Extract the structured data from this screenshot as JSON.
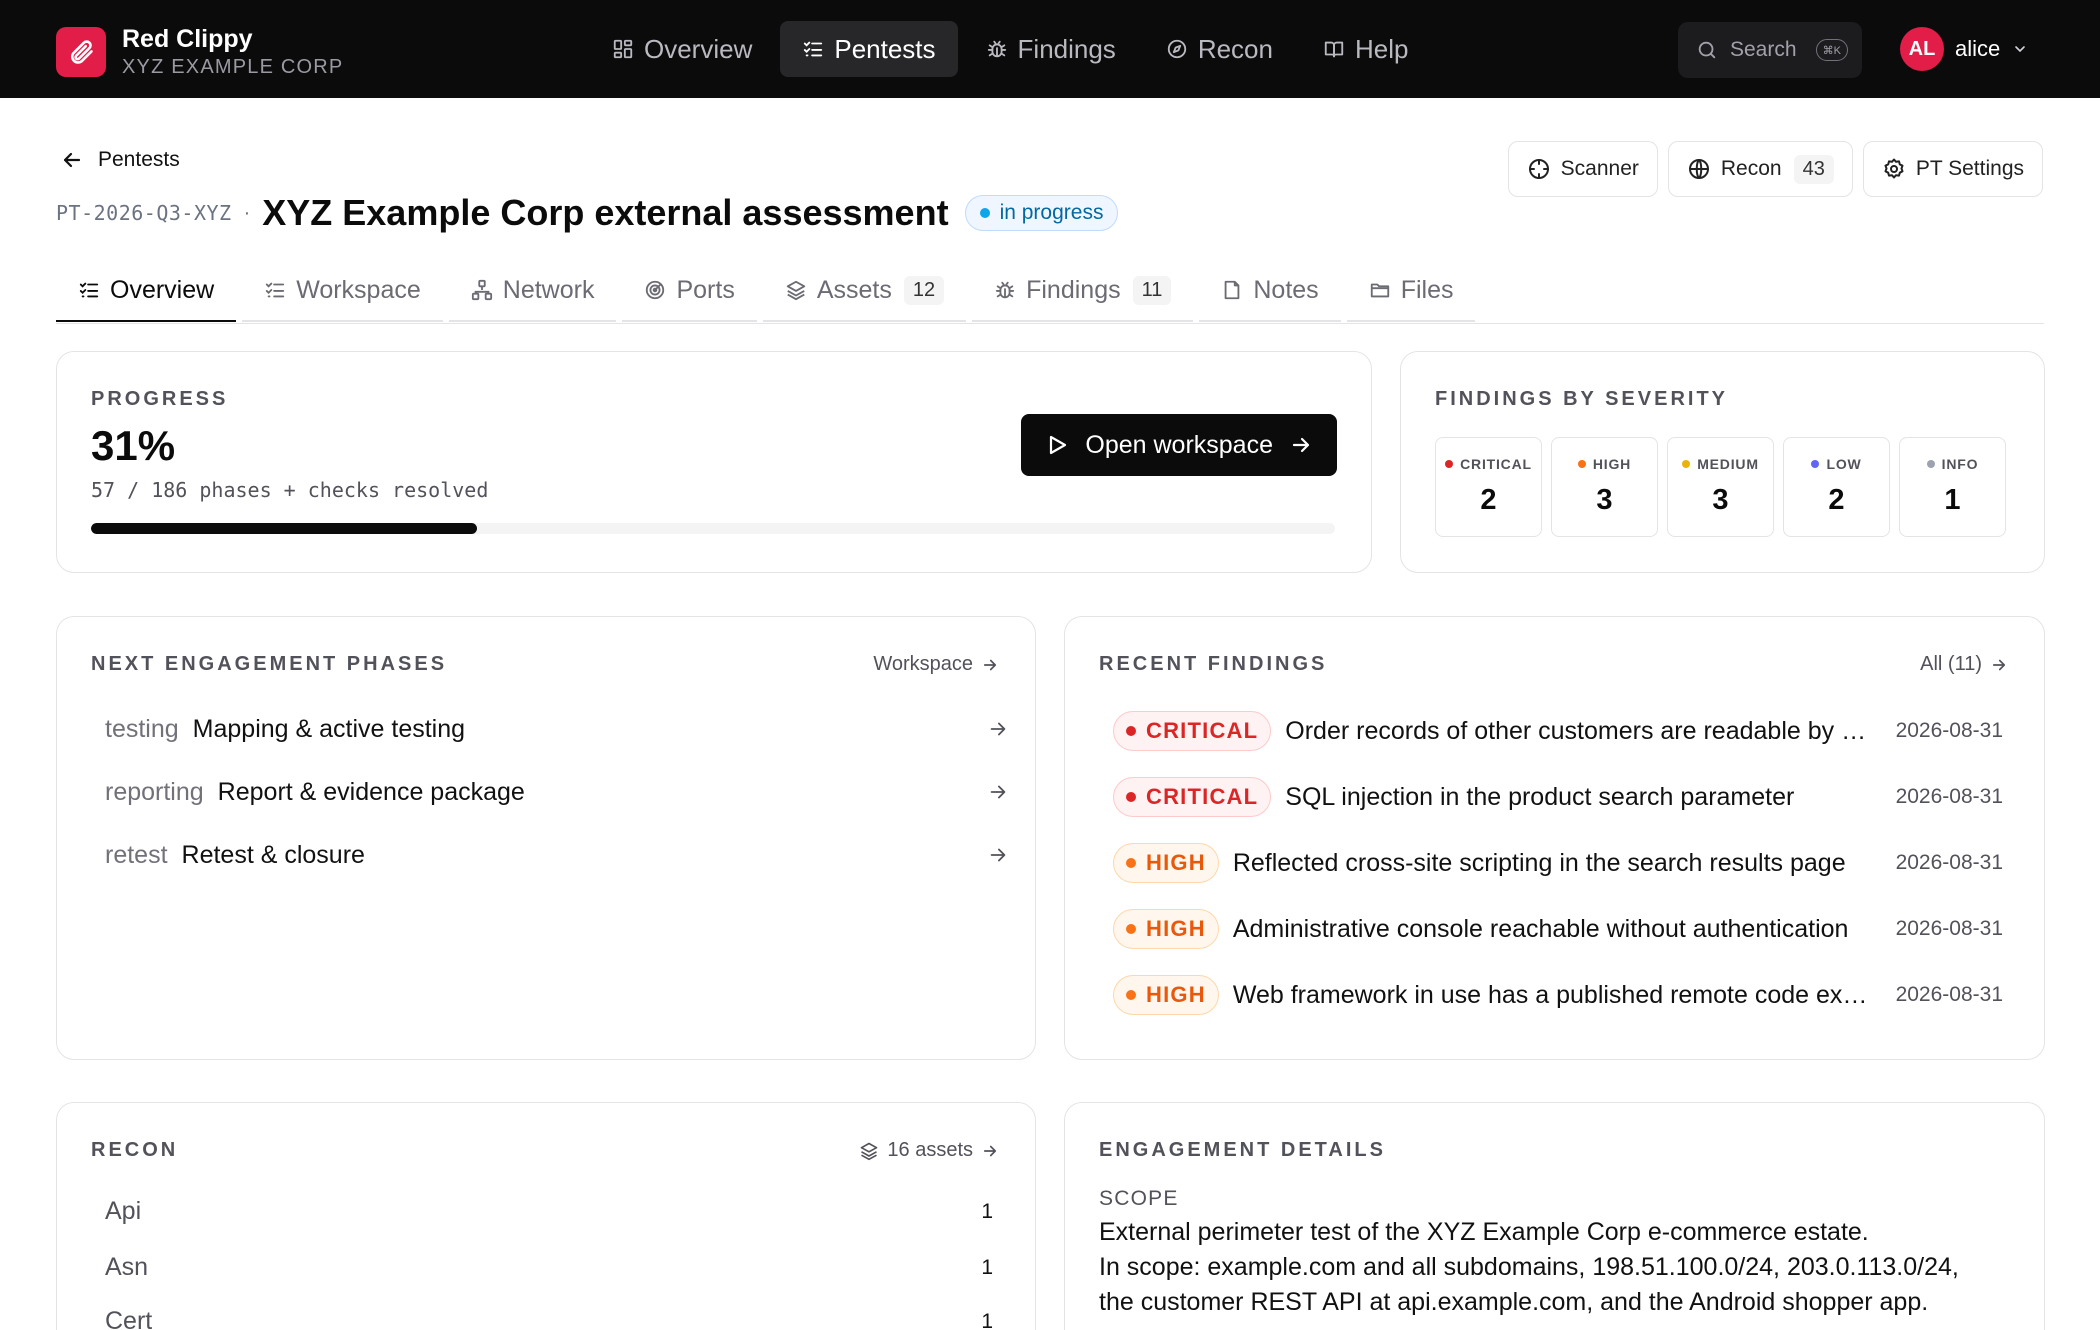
{
  "app": {
    "name": "Red Clippy",
    "org": "XYZ EXAMPLE CORP",
    "nav": [
      {
        "label": "Overview",
        "icon": "grid-icon",
        "active": false
      },
      {
        "label": "Pentests",
        "icon": "checklist-icon",
        "active": true
      },
      {
        "label": "Findings",
        "icon": "bug-icon",
        "active": false
      },
      {
        "label": "Recon",
        "icon": "compass-icon",
        "active": false
      },
      {
        "label": "Help",
        "icon": "book-icon",
        "active": false
      }
    ],
    "search_label": "Search",
    "search_shortcut": "⌘K",
    "user": {
      "initials": "AL",
      "name": "alice"
    }
  },
  "header": {
    "back_label": "Pentests",
    "id": "PT-2026-Q3-XYZ",
    "separator": "·",
    "title": "XYZ Example Corp external assessment",
    "status": "in progress",
    "actions": {
      "scanner": "Scanner",
      "recon": "Recon",
      "recon_count": "43",
      "settings": "PT Settings"
    }
  },
  "tabs": [
    {
      "label": "Overview",
      "active": true
    },
    {
      "label": "Workspace"
    },
    {
      "label": "Network"
    },
    {
      "label": "Ports"
    },
    {
      "label": "Assets",
      "count": "12"
    },
    {
      "label": "Findings",
      "count": "11"
    },
    {
      "label": "Notes"
    },
    {
      "label": "Files"
    }
  ],
  "progress": {
    "label": "PROGRESS",
    "percent_text": "31%",
    "percent_value": 31,
    "summary": "57 / 186 phases + checks resolved",
    "button": "Open workspace"
  },
  "severity": {
    "label": "FINDINGS BY SEVERITY",
    "items": [
      {
        "name": "CRITICAL",
        "count": "2",
        "color": "#dc2626"
      },
      {
        "name": "HIGH",
        "count": "3",
        "color": "#f97316"
      },
      {
        "name": "MEDIUM",
        "count": "3",
        "color": "#eab308"
      },
      {
        "name": "LOW",
        "count": "2",
        "color": "#6366f1"
      },
      {
        "name": "INFO",
        "count": "1",
        "color": "#9ca3af"
      }
    ]
  },
  "phases": {
    "label": "NEXT ENGAGEMENT PHASES",
    "link": "Workspace",
    "items": [
      {
        "key": "testing",
        "name": "Mapping & active testing"
      },
      {
        "key": "reporting",
        "name": "Report & evidence package"
      },
      {
        "key": "retest",
        "name": "Retest & closure"
      }
    ]
  },
  "recent_findings": {
    "label": "RECENT FINDINGS",
    "link": "All (11)",
    "items": [
      {
        "severity": "CRITICAL",
        "title": "Order records of other customers are readable by changing the order ID",
        "date": "2026-08-31"
      },
      {
        "severity": "CRITICAL",
        "title": "SQL injection in the product search parameter",
        "date": "2026-08-31"
      },
      {
        "severity": "HIGH",
        "title": "Reflected cross-site scripting in the search results page",
        "date": "2026-08-31"
      },
      {
        "severity": "HIGH",
        "title": "Administrative console reachable without authentication",
        "date": "2026-08-31"
      },
      {
        "severity": "HIGH",
        "title": "Web framework in use has a published remote code execution vulnerability",
        "date": "2026-08-31"
      }
    ]
  },
  "recon": {
    "label": "RECON",
    "link": "16 assets",
    "items": [
      {
        "name": "Api",
        "value": "1"
      },
      {
        "name": "Asn",
        "value": "1"
      },
      {
        "name": "Cert",
        "value": "1"
      }
    ]
  },
  "details": {
    "label": "ENGAGEMENT DETAILS",
    "scope_label": "SCOPE",
    "scope_lines": [
      "External perimeter test of the XYZ Example Corp e-commerce estate.",
      "In scope: example.com and all subdomains, 198.51.100.0/24, 203.0.113.0/24,",
      "the customer REST API at api.example.com, and the Android shopper app."
    ]
  }
}
